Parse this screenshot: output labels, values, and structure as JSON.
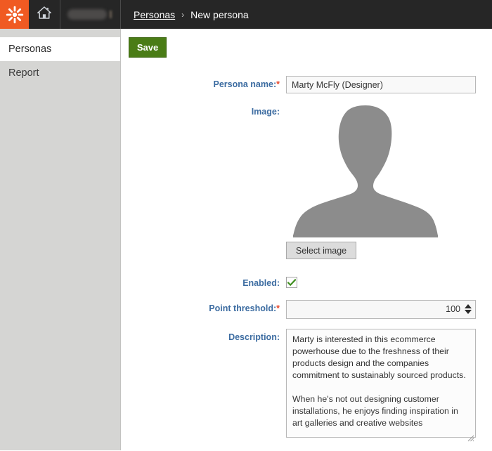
{
  "topbar": {
    "logo_icon": "kentico-asterisk-logo",
    "home_icon": "home-icon",
    "site_selector_label": "",
    "breadcrumb": {
      "parent": "Personas",
      "separator": "›",
      "current": "New persona"
    },
    "colors": {
      "bar_background": "#262626",
      "logo_background": "#f05a22"
    }
  },
  "sidebar": {
    "items": [
      {
        "label": "Personas",
        "active": true
      },
      {
        "label": "Report",
        "active": false
      }
    ],
    "background": "#d5d5d3"
  },
  "toolbar": {
    "save_label": "Save",
    "save_color": "#4a7c16"
  },
  "form": {
    "persona_name": {
      "label": "Persona name:",
      "required_marker": "*",
      "value": "Marty McFly (Designer)",
      "placeholder": ""
    },
    "image": {
      "label": "Image:",
      "placeholder_icon": "person-silhouette-icon",
      "select_button_label": "Select image",
      "silhouette_color": "#8c8c8c"
    },
    "enabled": {
      "label": "Enabled:",
      "checked": true,
      "check_color": "#3f8f1f"
    },
    "point_threshold": {
      "label": "Point threshold:",
      "required_marker": "*",
      "value": "100"
    },
    "description": {
      "label": "Description:",
      "value": "Marty is interested in this ecommerce powerhouse due to the freshness of their products design and the companies commitment to sustainably sourced products.\n\nWhen he's not out designing customer installations, he enjoys finding inspiration in art galleries and creative websites",
      "placeholder": ""
    },
    "label_color": "#3c6ca1",
    "required_color": "#e8472b"
  }
}
